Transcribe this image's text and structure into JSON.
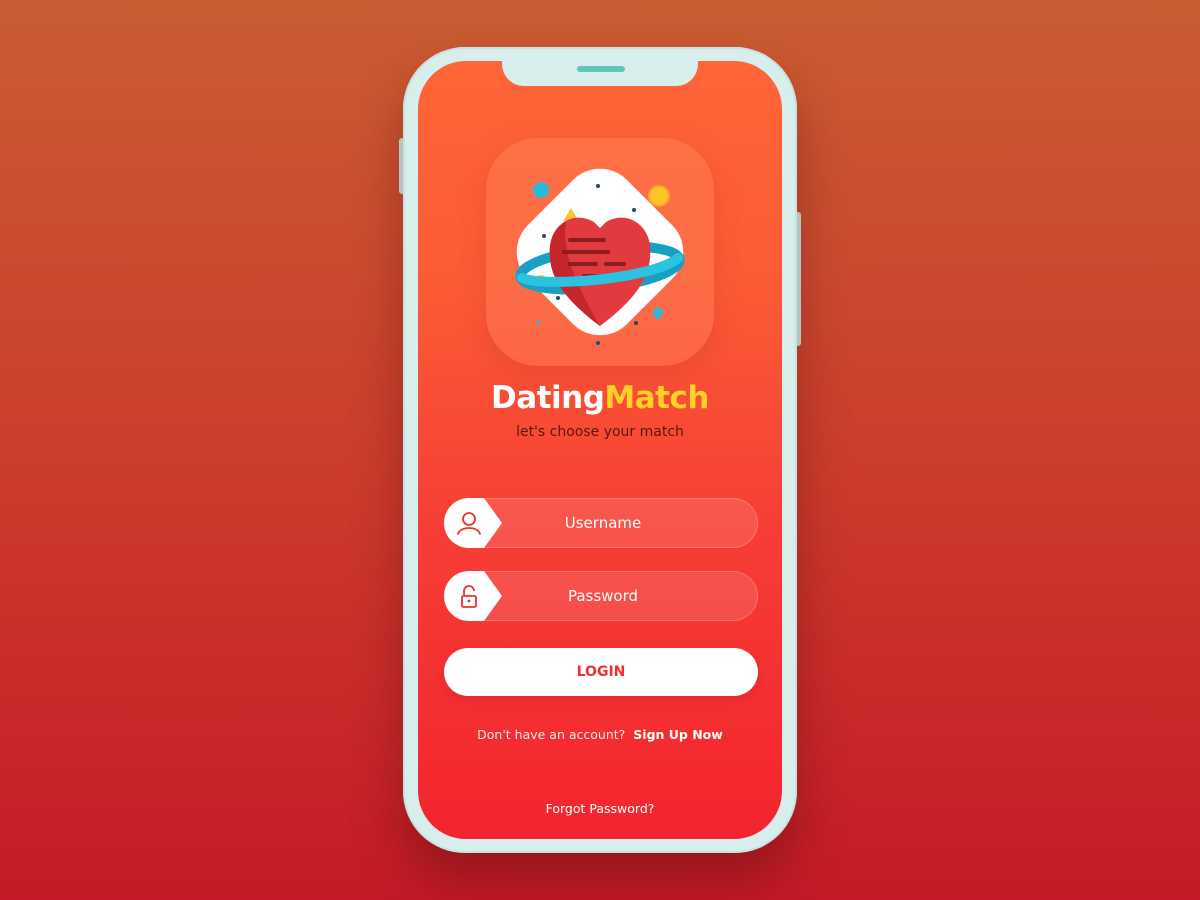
{
  "app": {
    "brand_part1": "Dating",
    "brand_part2": "Match",
    "tagline": "let's choose your match",
    "icon": "heart-planet-icon"
  },
  "login_form": {
    "username": {
      "placeholder": "Username",
      "value": "",
      "icon": "user-icon"
    },
    "password": {
      "placeholder": "Password",
      "value": "",
      "icon": "unlock-icon"
    },
    "login_label": "LOGIN"
  },
  "footer": {
    "no_account_text": "Don't have an account?",
    "signup_label": "Sign Up Now",
    "forgot_label": "Forgot Password?"
  },
  "colors": {
    "screen_top": "#fe6538",
    "screen_bottom": "#f3242e",
    "brand_accent": "#ffd02a",
    "login_text": "#f0302e"
  }
}
